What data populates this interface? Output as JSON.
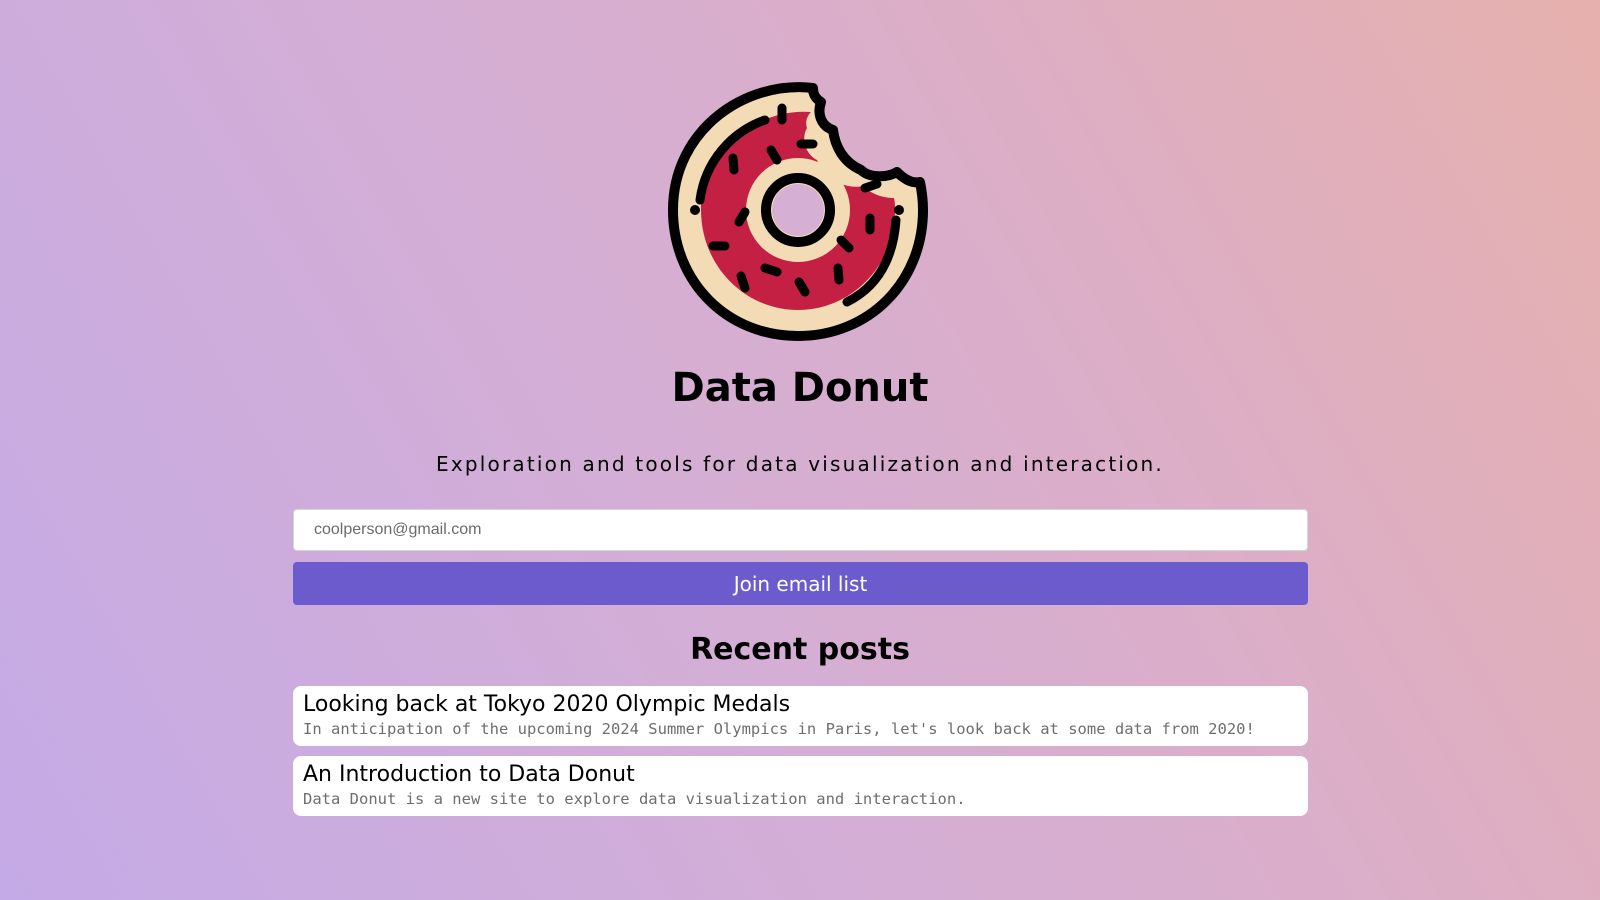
{
  "header": {
    "logo_icon": "donut-icon",
    "title": "Data Donut",
    "tagline": "Exploration and tools for data visualization and interaction."
  },
  "signup": {
    "email_placeholder": "coolperson@gmail.com",
    "email_value": "",
    "button_label": "Join email list"
  },
  "recent_posts": {
    "heading": "Recent posts",
    "items": [
      {
        "title": "Looking back at Tokyo 2020 Olympic Medals",
        "description": "In anticipation of the upcoming 2024 Summer Olympics in Paris, let's look back at some data from 2020!"
      },
      {
        "title": "An Introduction to Data Donut",
        "description": "Data Donut is a new site to explore data visualization and interaction."
      }
    ]
  },
  "colors": {
    "accent": "#6c5bcc",
    "donut_icing": "#c42043",
    "donut_dough": "#f3dcb5",
    "outline": "#000000"
  }
}
